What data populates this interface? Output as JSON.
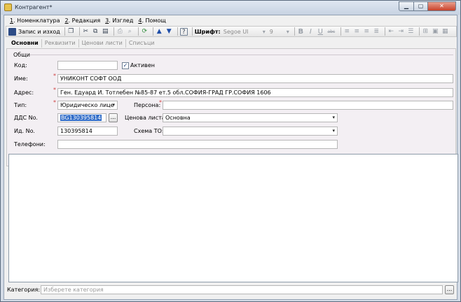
{
  "window": {
    "title": "Контрагент*",
    "min_glyph": "▁",
    "max_glyph": "▢",
    "close_glyph": "✕"
  },
  "menu": [
    {
      "key": "1",
      "label": ". Номенклатура"
    },
    {
      "key": "2",
      "label": ". Редакция"
    },
    {
      "key": "3",
      "label": ". Изглед"
    },
    {
      "key": "4",
      "label": ". Помощ"
    }
  ],
  "toolbar": {
    "save_label": "Запис и изход",
    "font_label": "Шрифт:",
    "font_value": "Segoe UI",
    "size_value": "9",
    "combo_glyph": "▾",
    "bold_glyph": "B",
    "italic_glyph": "I",
    "underline_glyph": "U",
    "strike_glyph": "abc",
    "icons": [
      "save-icon",
      "copy-window-icon",
      "cut-icon",
      "copy-icon",
      "paste-icon",
      "print-icon",
      "print-preview-icon",
      "refresh-icon",
      "arrow-up-icon",
      "arrow-down-icon",
      "help-icon"
    ]
  },
  "tabs": [
    "Основни",
    "Реквизити",
    "Ценови листи",
    "Списъци"
  ],
  "form": {
    "group_title": "Общи",
    "code_label": "Код:",
    "code_value": "",
    "active_label": "Активен",
    "active_checked": true,
    "check_glyph": "✓",
    "name_label": "Име:",
    "name_value": "УНИКОНТ СОФТ ООД",
    "address_label": "Адрес:",
    "address_value": "Ген. Едуард И. Тотлебен  №85-87 ет.5 обл.СОФИЯ-ГРАД ГР.СОФИЯ 1606",
    "type_label": "Тип:",
    "type_value": "Юридическо лице",
    "person_label": "Персона:",
    "person_value": "",
    "vat_label": "ДДС No.",
    "vat_value": "BG130395814",
    "dots": "...",
    "price_list_label": "Ценова листа:",
    "price_list_value": "Основна",
    "id_label": "Ид. No.",
    "id_value": "130395814",
    "scheme_label": "Схема ТО:",
    "scheme_value": "",
    "phones_label": "Телефони:",
    "phones_value": "",
    "required_mark": "*"
  },
  "notes_value": "",
  "category": {
    "label": "Категория:",
    "placeholder": "Изберете категория"
  }
}
